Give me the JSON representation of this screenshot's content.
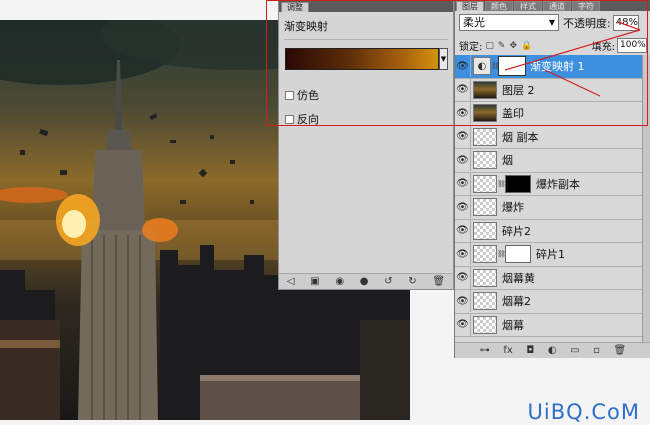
{
  "adjustments": {
    "tabs": [
      "调整",
      "蒙版"
    ],
    "title": "渐变映射",
    "gradient_colors": [
      "#2a0906",
      "#a45f0c",
      "#d4900d"
    ],
    "dither_label": "仿色",
    "reverse_label": "反向"
  },
  "layers_panel": {
    "tabs": [
      "图层",
      "颜色",
      "样式",
      "通道",
      "字符"
    ],
    "blend_mode": "柔光",
    "opacity_label": "不透明度:",
    "opacity_value": "48%",
    "lock_label": "锁定:",
    "fill_label": "填充:",
    "fill_value": "100%",
    "layers": [
      {
        "name": "渐变映射 1",
        "type": "adjustment",
        "mask": "white",
        "selected": true
      },
      {
        "name": "图层 2",
        "type": "photo"
      },
      {
        "name": "盖印",
        "type": "photo"
      },
      {
        "name": "烟 副本",
        "type": "transparent"
      },
      {
        "name": "烟",
        "type": "transparent"
      },
      {
        "name": "爆炸副本",
        "type": "transparent",
        "mask": "black"
      },
      {
        "name": "爆炸",
        "type": "transparent"
      },
      {
        "name": "碎片2",
        "type": "transparent"
      },
      {
        "name": "碎片1",
        "type": "transparent",
        "mask": "whitebox"
      },
      {
        "name": "烟幕黄",
        "type": "transparent"
      },
      {
        "name": "烟幕2",
        "type": "transparent"
      },
      {
        "name": "烟幕",
        "type": "transparent"
      }
    ]
  },
  "watermark": "UiBQ.CoM",
  "accent_colors": {
    "selection": "#3d8fe0",
    "highlight": "#d21d1d"
  }
}
